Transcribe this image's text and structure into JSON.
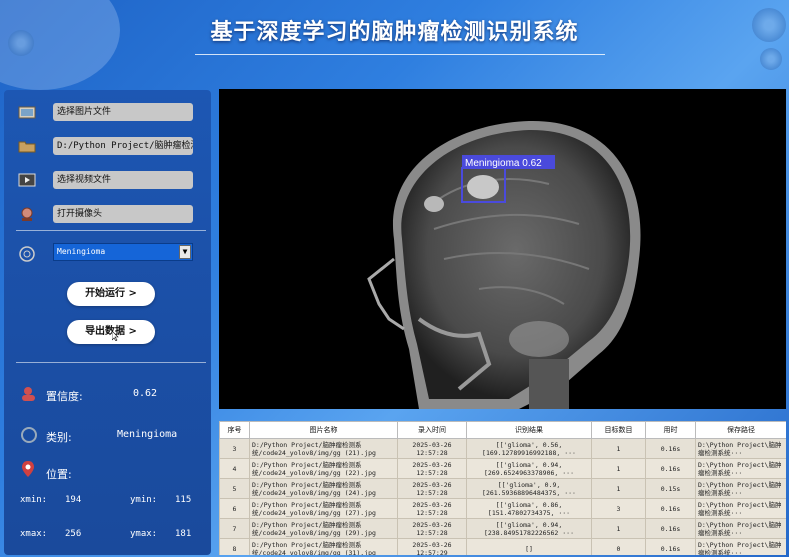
{
  "app": {
    "title": "基于深度学习的脑肿瘤检测识别系统"
  },
  "sidebar": {
    "select_image": "选择图片文件",
    "folder_path": "D:/Python Project/脑肿瘤检测",
    "select_video": "选择视频文件",
    "open_camera": "打开摄像头",
    "target_select": {
      "selected": "Meningioma"
    },
    "run_button": "开始运行 >",
    "export_button": "导出数据 >"
  },
  "info": {
    "confidence_label": "置信度:",
    "confidence_value": "0.62",
    "class_label": "类别:",
    "class_value": "Meningioma",
    "position_label": "位置:",
    "xmin_label": "xmin:",
    "xmin_value": "194",
    "ymin_label": "ymin:",
    "ymin_value": "115",
    "xmax_label": "xmax:",
    "xmax_value": "256",
    "ymax_label": "ymax:",
    "ymax_value": "181"
  },
  "viewer": {
    "detection_label": "Meningioma 0.62",
    "box_color": "#4a4adc"
  },
  "table": {
    "headers": [
      "序号",
      "图片名称",
      "录入时间",
      "识别结果",
      "目标数目",
      "用时",
      "保存路径"
    ],
    "rows": [
      {
        "id": "3",
        "name": "D:/Python Project/脑肿瘤检测系统/code24_yolov8/img/gg (21).jpg",
        "time": "2025-03-26 12:57:28",
        "result": "[['glioma', 0.56, [169.12789916992188, ···",
        "count": "1",
        "elapsed": "0.16s",
        "path": "D:\\Python Project\\脑肿瘤检测系统···"
      },
      {
        "id": "4",
        "name": "D:/Python Project/脑肿瘤检测系统/code24_yolov8/img/gg (22).jpg",
        "time": "2025-03-26 12:57:28",
        "result": "[['glioma', 0.94, [269.6524963378906, ···",
        "count": "1",
        "elapsed": "0.16s",
        "path": "D:\\Python Project\\脑肿瘤检测系统···"
      },
      {
        "id": "5",
        "name": "D:/Python Project/脑肿瘤检测系统/code24_yolov8/img/gg (24).jpg",
        "time": "2025-03-26 12:57:28",
        "result": "[['glioma', 0.9, [261.5936889648437S, ···",
        "count": "1",
        "elapsed": "0.15s",
        "path": "D:\\Python Project\\脑肿瘤检测系统···"
      },
      {
        "id": "6",
        "name": "D:/Python Project/脑肿瘤检测系统/code24_yolov8/img/gg (27).jpg",
        "time": "2025-03-26 12:57:28",
        "result": "[['glioma', 0.86, [151.47802734375, ···",
        "count": "3",
        "elapsed": "0.16s",
        "path": "D:\\Python Project\\脑肿瘤检测系统···"
      },
      {
        "id": "7",
        "name": "D:/Python Project/脑肿瘤检测系统/code24_yolov8/img/gg (29).jpg",
        "time": "2025-03-26 12:57:28",
        "result": "[['glioma', 0.94, [238.84951782226562 ···",
        "count": "1",
        "elapsed": "0.16s",
        "path": "D:\\Python Project\\脑肿瘤检测系统···"
      },
      {
        "id": "8",
        "name": "D:/Python Project/脑肿瘤检测系统/code24_yolov8/img/gg (31).jpg",
        "time": "2025-03-26 12:57:29",
        "result": "[]",
        "count": "0",
        "elapsed": "0.16s",
        "path": "D:\\Python Project\\脑肿瘤检测系统···"
      }
    ]
  }
}
